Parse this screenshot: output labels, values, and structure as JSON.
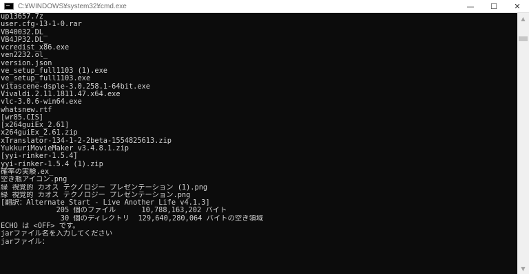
{
  "window": {
    "title": "C:¥WINDOWS¥system32¥cmd.exe",
    "buttons": {
      "minimize": "—",
      "maximize": "☐",
      "close": "✕"
    }
  },
  "console": {
    "lines": [
      "up13657.7z",
      "user.cfg-13-1-0.rar",
      "VB40032.DL_",
      "VB4JP32.DL_",
      "vcredist_x86.exe",
      "ven2232.ol_",
      "version.json",
      "ve_setup_full1103 (1).exe",
      "ve_setup_full1103.exe",
      "vitascene-dsple-3.0.258.1-64bit.exe",
      "Vivaldi.2.11.1811.47.x64.exe",
      "vlc-3.0.6-win64.exe",
      "whatsnew.rtf",
      "[wr85.CIS]",
      "[x264guiEx_2.61]",
      "x264guiEx_2.61.zip",
      "xTranslator-134-1-2-2beta-1554825613.zip",
      "YukkuriMovieMaker_v3.4.8.1.zip",
      "[yyi-rinker-1.5.4]",
      "yyi-rinker-1.5.4 (1).zip",
      "確率の実験.ex_",
      "空き瓶アイコン.png",
      "緑 視覚的 カオス テクノロジー プレゼンテーション (1).png",
      "緑 視覚的 カオス テクノロジー プレゼンテーション.png",
      "[翻訳：Alternate Start - Live Another Life v4.1.3]",
      "             205 個のファイル      10,788,163,202 バイト",
      "              30 個のディレクトリ  129,640,280,064 バイトの空き領域",
      "ECHO は <OFF> です。",
      "jarファイル名を入力してください",
      "jarファイル："
    ]
  },
  "scrollbar": {
    "up_arrow": "▲",
    "down_arrow": "▼",
    "position": 0.02
  }
}
